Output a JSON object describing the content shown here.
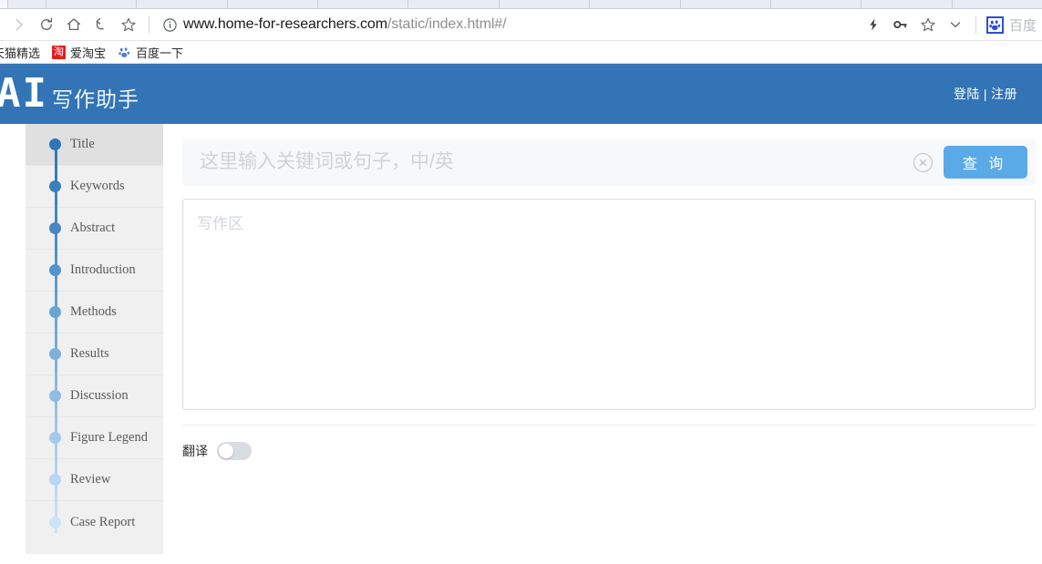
{
  "browser": {
    "toolbar_icons": [
      "forward-icon",
      "reload-icon",
      "home-icon",
      "back-arrow-icon",
      "bookmark-star-icon"
    ],
    "url_main": "www.home-for-researchers.com",
    "url_path": "/static/index.html#/",
    "site_info_icon": "info-circle-icon",
    "right_icons": [
      "lightning-icon",
      "key-icon",
      "star-icon",
      "chevron-down-icon"
    ],
    "extension_label": "百度",
    "bookmarks": [
      {
        "label": "天猫精选",
        "icon": "none"
      },
      {
        "label": "爱淘宝",
        "icon": "taobao-icon",
        "icon_text": "淘"
      },
      {
        "label": "百度一下",
        "icon": "baidu-paw-icon"
      }
    ]
  },
  "header": {
    "logo_ai": "AI",
    "logo_cn": "写作助手",
    "login_label": "登陆",
    "separator": "|",
    "register_label": "注册",
    "background_color": "#3274b5"
  },
  "sidebar": {
    "items": [
      {
        "label": "Title",
        "active": true,
        "dot_color": "#2f76b8"
      },
      {
        "label": "Keywords",
        "active": false,
        "dot_color": "#3a7fbd"
      },
      {
        "label": "Abstract",
        "active": false,
        "dot_color": "#4588c4"
      },
      {
        "label": "Introduction",
        "active": false,
        "dot_color": "#5494cc"
      },
      {
        "label": "Methods",
        "active": false,
        "dot_color": "#6aa4d7"
      },
      {
        "label": "Results",
        "active": false,
        "dot_color": "#7db0dd"
      },
      {
        "label": "Discussion",
        "active": false,
        "dot_color": "#8ebce5"
      },
      {
        "label": "Figure Legend",
        "active": false,
        "dot_color": "#a3c9ed"
      },
      {
        "label": "Review",
        "active": false,
        "dot_color": "#b8d6f3"
      },
      {
        "label": "Case Report",
        "active": false,
        "dot_color": "#cde3f8"
      }
    ]
  },
  "main": {
    "search": {
      "value": "",
      "placeholder": "这里输入关键词或句子，中/英",
      "clear_icon": "clear-circle-icon",
      "button_label": "查 询",
      "button_color": "#5aaae8"
    },
    "editor": {
      "value": "",
      "placeholder": "写作区"
    },
    "translate": {
      "label": "翻译",
      "enabled": false
    }
  }
}
